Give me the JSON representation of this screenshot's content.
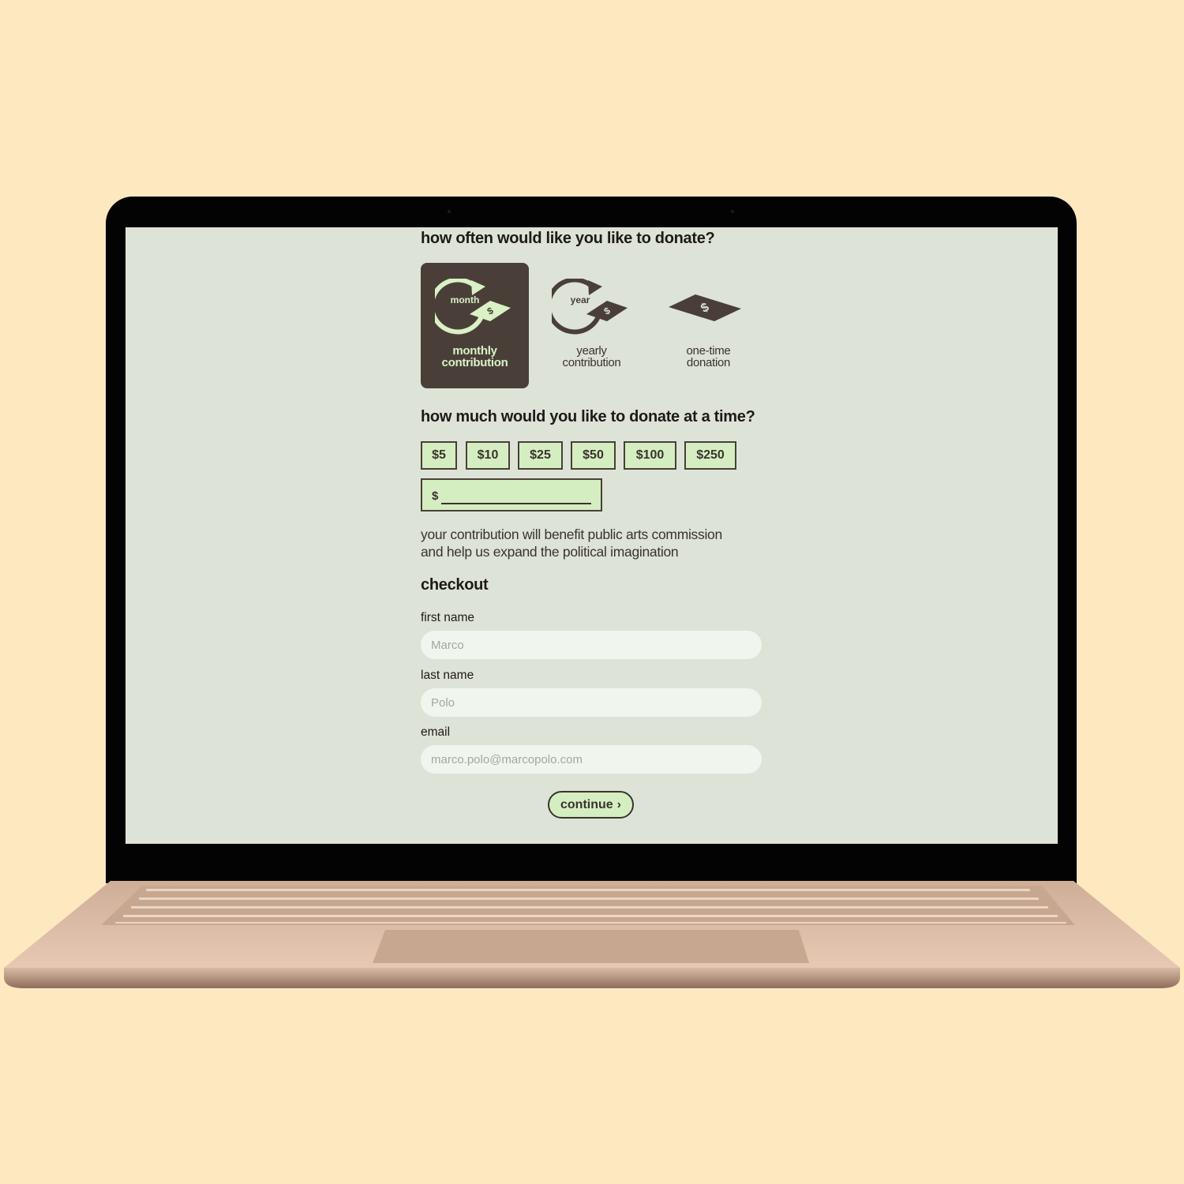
{
  "frequency": {
    "question": "how often would like you like to donate?",
    "options": [
      {
        "icon_text": "month",
        "line1": "monthly",
        "line2": "contribution",
        "selected": true
      },
      {
        "icon_text": "year",
        "line1": "yearly",
        "line2": "contribution",
        "selected": false
      },
      {
        "icon_text": "",
        "line1": "one-time",
        "line2": "donation",
        "selected": false
      }
    ]
  },
  "amount": {
    "question": "how much would you like to donate at a time?",
    "presets": [
      "$5",
      "$10",
      "$25",
      "$50",
      "$100",
      "$250"
    ],
    "custom_prefix": "$"
  },
  "benefit": {
    "line1": "your contribution will benefit public arts commission",
    "line2": "and help us expand the political imagination"
  },
  "checkout": {
    "title": "checkout",
    "fields": {
      "first_name": {
        "label": "first name",
        "placeholder": "Marco"
      },
      "last_name": {
        "label": "last name",
        "placeholder": "Polo"
      },
      "email": {
        "label": "email",
        "placeholder": "marco.polo@marcopolo.com"
      }
    },
    "continue_label": "continue"
  },
  "colors": {
    "page_background": "#fee8c0",
    "screen_background": "#dde3d7",
    "accent_dark": "#4a3f38",
    "accent_light": "#d4eec1",
    "input_background": "#f0f6ee"
  }
}
